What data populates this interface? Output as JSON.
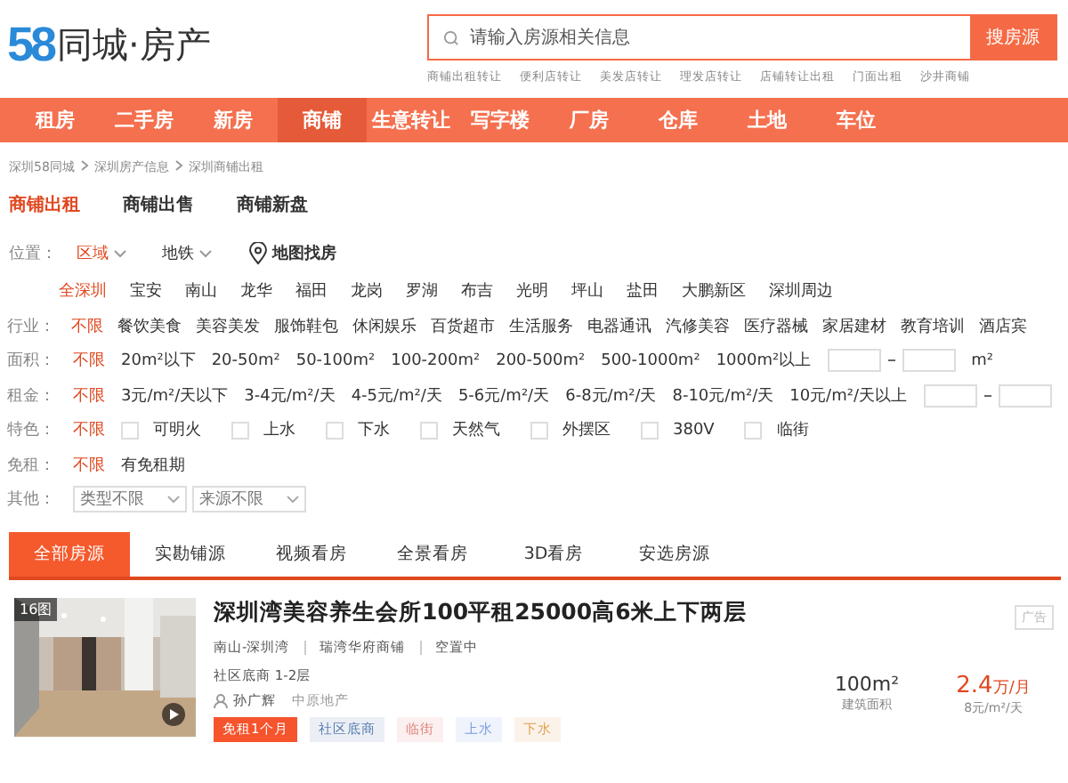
{
  "logo": {
    "number": "58",
    "text": "同城·房产"
  },
  "search": {
    "placeholder": "请输入房源相关信息",
    "button": "搜房源",
    "hot_words": [
      "商铺出租转让",
      "便利店转让",
      "美发店转让",
      "理发店转让",
      "店铺转让出租",
      "门面出租",
      "沙井商铺"
    ]
  },
  "nav": [
    {
      "label": "租房",
      "selected": false
    },
    {
      "label": "二手房",
      "selected": false
    },
    {
      "label": "新房",
      "selected": false
    },
    {
      "label": "商铺",
      "selected": true
    },
    {
      "label": "生意转让",
      "selected": false
    },
    {
      "label": "写字楼",
      "selected": false
    },
    {
      "label": "厂房",
      "selected": false
    },
    {
      "label": "仓库",
      "selected": false
    },
    {
      "label": "土地",
      "selected": false
    },
    {
      "label": "车位",
      "selected": false
    }
  ],
  "breadcrumb": [
    "深圳58同城",
    "深圳房产信息",
    "深圳商铺出租"
  ],
  "sub_tabs": [
    {
      "label": "商铺出租",
      "selected": true
    },
    {
      "label": "商铺出售",
      "selected": false
    },
    {
      "label": "商铺新盘",
      "selected": false
    }
  ],
  "location": {
    "label": "位置：",
    "options": [
      {
        "label": "区域",
        "selected": true
      },
      {
        "label": "地铁",
        "selected": false
      }
    ],
    "map": "地图找房"
  },
  "districts": [
    {
      "label": "全深圳",
      "selected": true
    },
    {
      "label": "宝安",
      "selected": false
    },
    {
      "label": "南山",
      "selected": false
    },
    {
      "label": "龙华",
      "selected": false
    },
    {
      "label": "福田",
      "selected": false
    },
    {
      "label": "龙岗",
      "selected": false
    },
    {
      "label": "罗湖",
      "selected": false
    },
    {
      "label": "布吉",
      "selected": false
    },
    {
      "label": "光明",
      "selected": false
    },
    {
      "label": "坪山",
      "selected": false
    },
    {
      "label": "盐田",
      "selected": false
    },
    {
      "label": "大鹏新区",
      "selected": false
    },
    {
      "label": "深圳周边",
      "selected": false
    }
  ],
  "filters": [
    {
      "kind": "links",
      "label": "行业：",
      "items": [
        {
          "label": "不限",
          "selected": true
        },
        {
          "label": "餐饮美食",
          "selected": false
        },
        {
          "label": "美容美发",
          "selected": false
        },
        {
          "label": "服饰鞋包",
          "selected": false
        },
        {
          "label": "休闲娱乐",
          "selected": false
        },
        {
          "label": "百货超市",
          "selected": false
        },
        {
          "label": "生活服务",
          "selected": false
        },
        {
          "label": "电器通讯",
          "selected": false
        },
        {
          "label": "汽修美容",
          "selected": false
        },
        {
          "label": "医疗器械",
          "selected": false
        },
        {
          "label": "家居建材",
          "selected": false
        },
        {
          "label": "教育培训",
          "selected": false
        },
        {
          "label": "酒店宾",
          "selected": false
        }
      ]
    },
    {
      "kind": "links",
      "label": "面积：",
      "items": [
        {
          "label": "不限",
          "selected": true
        },
        {
          "label": "20m²以下",
          "selected": false
        },
        {
          "label": "20-50m²",
          "selected": false
        },
        {
          "label": "50-100m²",
          "selected": false
        },
        {
          "label": "100-200m²",
          "selected": false
        },
        {
          "label": "200-500m²",
          "selected": false
        },
        {
          "label": "500-1000m²",
          "selected": false
        },
        {
          "label": "1000m²以上",
          "selected": false
        }
      ],
      "has_range": true,
      "range_unit": "m²"
    },
    {
      "kind": "links",
      "label": "租金：",
      "items": [
        {
          "label": "不限",
          "selected": true
        },
        {
          "label": "3元/m²/天以下",
          "selected": false
        },
        {
          "label": "3-4元/m²/天",
          "selected": false
        },
        {
          "label": "4-5元/m²/天",
          "selected": false
        },
        {
          "label": "5-6元/m²/天",
          "selected": false
        },
        {
          "label": "6-8元/m²/天",
          "selected": false
        },
        {
          "label": "8-10元/m²/天",
          "selected": false
        },
        {
          "label": "10元/m²/天以上",
          "selected": false
        }
      ],
      "has_range": true
    },
    {
      "kind": "checks",
      "label": "特色：",
      "items": [
        {
          "label": "不限",
          "selected": true
        },
        {
          "label": "可明火",
          "checked": false
        },
        {
          "label": "上水",
          "checked": false
        },
        {
          "label": "下水",
          "checked": false
        },
        {
          "label": "天然气",
          "checked": false
        },
        {
          "label": "外摆区",
          "checked": false
        },
        {
          "label": "380V",
          "checked": false
        },
        {
          "label": "临街",
          "checked": false
        }
      ]
    },
    {
      "kind": "links",
      "label": "免租：",
      "items": [
        {
          "label": "不限",
          "selected": true
        },
        {
          "label": "有免租期",
          "selected": false
        }
      ]
    },
    {
      "kind": "selects",
      "label": "其他：",
      "items": [
        {
          "label": "类型不限"
        },
        {
          "label": "来源不限"
        }
      ]
    }
  ],
  "list_tabs": [
    {
      "label": "全部房源",
      "selected": true
    },
    {
      "label": "实勘铺源",
      "selected": false
    },
    {
      "label": "视频看房",
      "selected": false
    },
    {
      "label": "全景看房",
      "selected": false
    },
    {
      "label": "3D看房",
      "selected": false
    },
    {
      "label": "安选房源",
      "selected": false
    }
  ],
  "listing": {
    "photo_count": "16图",
    "title": "深圳湾美容养生会所100平租25000高6米上下两层",
    "meta": [
      "南山-深圳湾",
      "瑞湾华府商铺",
      "空置中"
    ],
    "floor": "社区底商 1-2层",
    "agent": "孙广辉",
    "agency": "中原地产",
    "tags": [
      {
        "label": "免租1个月",
        "color": "#f5542d",
        "solid": true
      },
      {
        "label": "社区底商",
        "color": "#5a7eb0",
        "solid": false
      },
      {
        "label": "临街",
        "color": "#e0837a",
        "solid": false
      },
      {
        "label": "上水",
        "color": "#7a9be0",
        "solid": false
      },
      {
        "label": "下水",
        "color": "#e0a050",
        "solid": false
      }
    ],
    "area": "100m²",
    "area_label": "建筑面积",
    "price": "2.4",
    "price_unit": "万/月",
    "unit_price": "8元/m²/天",
    "ad": "广告"
  }
}
